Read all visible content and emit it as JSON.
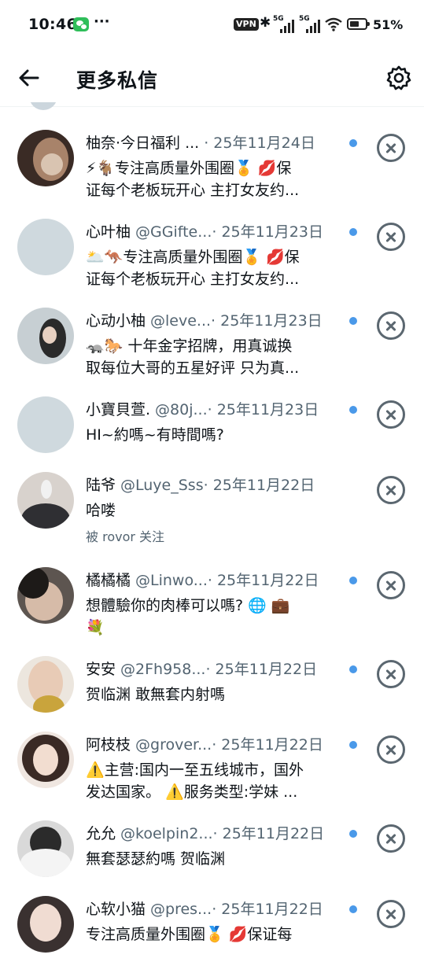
{
  "status_bar": {
    "time": "10:46",
    "more": "···",
    "vpn": "VPN",
    "network1": "5G",
    "network2": "5G",
    "battery": "51%"
  },
  "header": {
    "title": "更多私信"
  },
  "messages": [
    {
      "name": "柚奈·今日福利 ...",
      "handle": "",
      "date": "· 25年11月24日",
      "line1": "⚡🐐专注高质量外围圈🏅 💋保",
      "line2": "证每个老板玩开心 主打女友约...",
      "note": ""
    },
    {
      "name": "心叶柚",
      "handle": "@GGifte...",
      "date": "· 25年11月23日",
      "line1": "🌥️🦘专注高质量外围圈🏅 💋保",
      "line2": "证每个老板玩开心 主打女友约...",
      "note": ""
    },
    {
      "name": "心动小柚",
      "handle": "@leve...",
      "date": "· 25年11月23日",
      "line1": "🦡🐎 十年金字招牌，用真诚换",
      "line2": "取每位大哥的五星好评  只为真...",
      "note": ""
    },
    {
      "name": "小寶貝萱.",
      "handle": "@80j...",
      "date": "· 25年11月23日",
      "line1": "HI~約嗎~有時間嗎?",
      "line2": "",
      "note": ""
    },
    {
      "name": "陆爷",
      "handle": "@Luye_Sss",
      "date": "· 25年11月22日",
      "line1": "哈喽",
      "line2": "",
      "note": "被 rovor 关注"
    },
    {
      "name": "橘橘橘",
      "handle": "@Linwo...",
      "date": "· 25年11月22日",
      "line1": "想體驗你的肉棒可以嗎? 🌐 💼",
      "line2": "💐",
      "note": ""
    },
    {
      "name": "安安",
      "handle": "@2Fh958...",
      "date": "· 25年11月22日",
      "line1": "贺临渊 敢無套内射嗎",
      "line2": "",
      "note": ""
    },
    {
      "name": "阿枝枝",
      "handle": "@grover...",
      "date": "· 25年11月22日",
      "line1": "⚠️主营:国内一至五线城市，国外",
      "line2": "发达国家。 ⚠️服务类型:学妹 ...",
      "note": ""
    },
    {
      "name": "允允",
      "handle": "@koelpin2...",
      "date": "· 25年11月22日",
      "line1": "無套瑟瑟約嗎 贺临渊",
      "line2": "",
      "note": ""
    },
    {
      "name": "心软小猫",
      "handle": "@pres...",
      "date": "· 25年11月22日",
      "line1": "专注高质量外围圈🏅 💋保证每",
      "line2": "",
      "note": ""
    }
  ]
}
